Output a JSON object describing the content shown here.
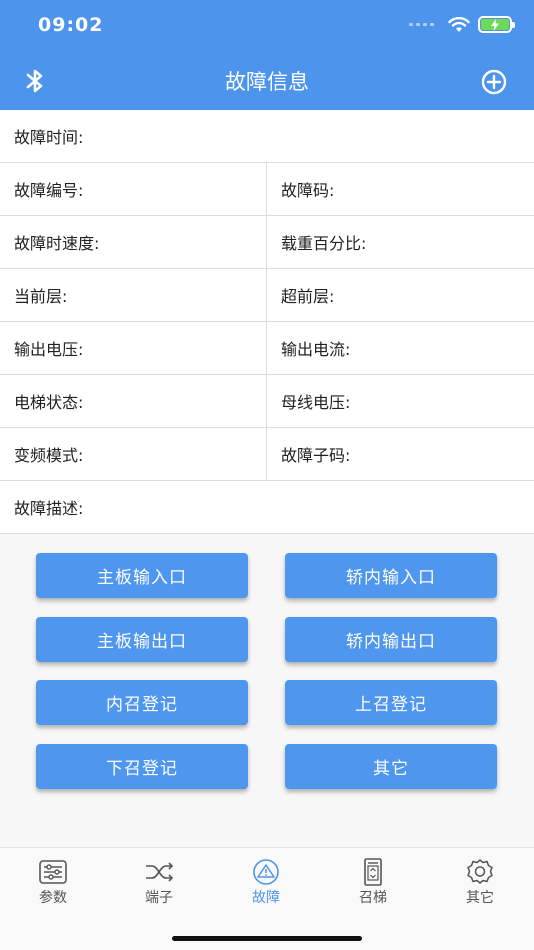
{
  "status": {
    "time": "09:02"
  },
  "header": {
    "title": "故障信息",
    "left_icon": "bluetooth-icon",
    "right_icon": "add-circle-icon"
  },
  "form": {
    "fault_time": "故障时间:",
    "fault_number": "故障编号:",
    "fault_code": "故障码:",
    "fault_speed": "故障时速度:",
    "load_percent": "载重百分比:",
    "current_floor": "当前层:",
    "advance_floor": "超前层:",
    "output_voltage": "输出电压:",
    "output_current": "输出电流:",
    "elevator_state": "电梯状态:",
    "bus_voltage": "母线电压:",
    "inverter_mode": "变频模式:",
    "fault_subcode": "故障子码:",
    "fault_description": "故障描述:"
  },
  "buttons": {
    "main_input": "主板输入口",
    "car_input": "轿内输入口",
    "main_output": "主板输出口",
    "car_output": "轿内输出口",
    "inner_call": "内召登记",
    "up_call": "上召登记",
    "down_call": "下召登记",
    "other": "其它"
  },
  "tabs": [
    {
      "label": "参数",
      "icon": "sliders-icon"
    },
    {
      "label": "端子",
      "icon": "shuffle-icon"
    },
    {
      "label": "故障",
      "icon": "warning-icon"
    },
    {
      "label": "召梯",
      "icon": "elevator-icon"
    },
    {
      "label": "其它",
      "icon": "gear-icon"
    }
  ],
  "colors": {
    "header": "#4d94ec",
    "button": "#4f96ee",
    "active_tab": "#4d94ec"
  }
}
